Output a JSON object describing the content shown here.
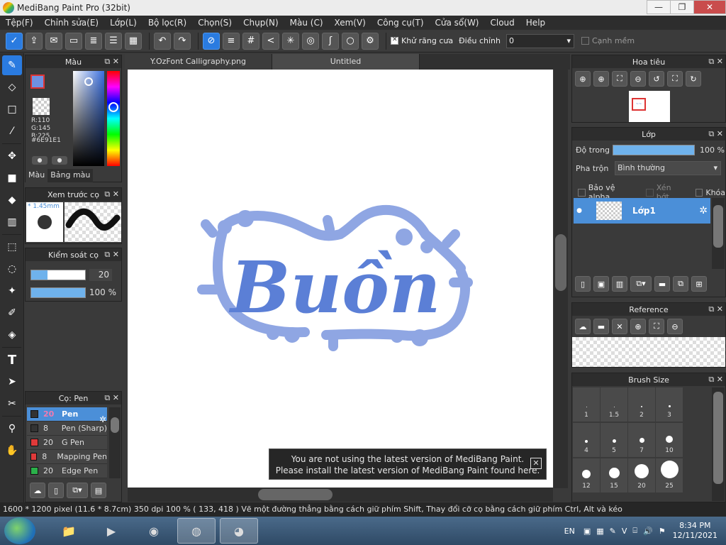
{
  "window": {
    "title": "MediBang Paint Pro (32bit)",
    "min": "—",
    "max": "❐",
    "close": "✕"
  },
  "menu": [
    "Tệp(F)",
    "Chỉnh sửa(E)",
    "Lớp(L)",
    "Bộ lọc(R)",
    "Chọn(S)",
    "Chụp(N)",
    "Màu (C)",
    "Xem(V)",
    "Công cụ(T)",
    "Cửa sổ(W)",
    "Cloud",
    "Help"
  ],
  "toolbar": {
    "antialias_label": "Khử răng cưa",
    "adjust_label": "Điều chỉnh",
    "adjust_value": "0",
    "soft_edge_label": "Cạnh mềm"
  },
  "color_panel": {
    "title": "Màu",
    "r": "R:110",
    "g": "G:145",
    "b": "B:225",
    "hex": "#6E91E1",
    "tab_color": "Màu",
    "tab_palette": "Bảng màu",
    "primary": "#6E91E1"
  },
  "brush_preview": {
    "title": "Xem trước cọ",
    "size": "* 1.45mm"
  },
  "brush_control": {
    "title": "Kiểm soát cọ",
    "size_value": "20",
    "size_fill": 0.3,
    "opacity_value": "100 %",
    "opacity_fill": 1.0
  },
  "brush_list": {
    "title": "Cọ: Pen",
    "items": [
      {
        "size": "20",
        "name": "Pen",
        "color": "#333333",
        "selected": true
      },
      {
        "size": "8",
        "name": "Pen (Sharp)",
        "color": "#333333",
        "selected": false
      },
      {
        "size": "20",
        "name": "G Pen",
        "color": "#e03a3a",
        "selected": false
      },
      {
        "size": "8",
        "name": "Mapping Pen",
        "color": "#e03a3a",
        "selected": false
      },
      {
        "size": "20",
        "name": "Edge Pen",
        "color": "#2bb04a",
        "selected": false
      }
    ]
  },
  "tabs": [
    "Y.OzFont Calligraphy.png",
    "Untitled"
  ],
  "canvas": {
    "word": "Buồn",
    "ink": "#5B7FD6",
    "ink_light": "#8FA6E3"
  },
  "toast": {
    "line1": "You are not using the latest version of MediBang Paint.",
    "line2": "Please install the latest version of MediBang Paint found here.",
    "close": "✕"
  },
  "navigator": {
    "title": "Hoa tiêu"
  },
  "layer_panel": {
    "title": "Lớp",
    "opacity_label": "Độ trong",
    "opacity_value": "100 %",
    "blend_label": "Pha trộn",
    "blend_value": "Bình thường",
    "protect_alpha": "Bảo vệ alpha",
    "clipping": "Xén bớt",
    "lock": "Khóa",
    "layer_name": "Lớp1"
  },
  "reference": {
    "title": "Reference"
  },
  "brush_size": {
    "title": "Brush Size",
    "sizes": [
      "1",
      "1.5",
      "2",
      "3",
      "4",
      "5",
      "7",
      "10",
      "12",
      "15",
      "20",
      "25"
    ]
  },
  "status": "1600 * 1200 pixel  (11.6 * 8.7cm)  350 dpi  100 %  ( 133, 418 )  Vẽ một đường thẳng bằng cách giữ phím Shift, Thay đổi cỡ cọ bằng cách giữ phím Ctrl, Alt và kéo",
  "taskbar": {
    "lang": "EN",
    "time": "8:34 PM",
    "date": "12/11/2021"
  }
}
